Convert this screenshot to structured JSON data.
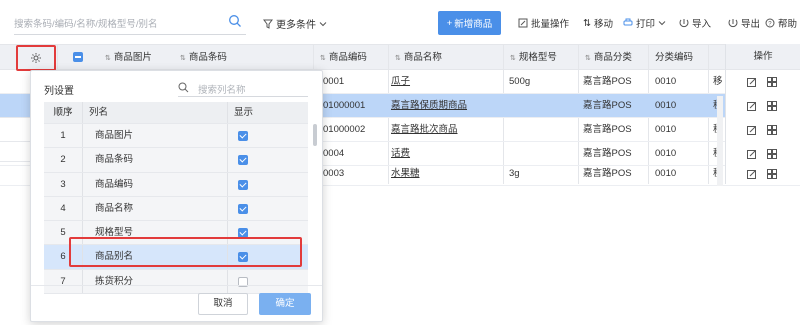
{
  "toolbar": {
    "search_placeholder": "搜索条码/编码/名称/规格型号/别名",
    "more_filters": "更多条件",
    "add_button": "新增商品",
    "batch": "批量操作",
    "move": "移动",
    "print": "打印",
    "import": "导入",
    "export": "导出",
    "help": "帮助"
  },
  "table": {
    "headers": [
      "商品图片",
      "商品条码",
      "商品编码",
      "商品名称",
      "规格型号",
      "商品分类",
      "分类编码",
      "操作"
    ],
    "rows": [
      {
        "code": "0001",
        "name": "瓜子",
        "spec": "500g",
        "category": "嘉言路POS",
        "cat_code": "0010",
        "extra": "移"
      },
      {
        "code": "01000001",
        "name": "嘉言路保质期商品",
        "spec": "",
        "category": "嘉言路POS",
        "cat_code": "0010",
        "extra": "移"
      },
      {
        "code": "01000002",
        "name": "嘉言路批次商品",
        "spec": "",
        "category": "嘉言路POS",
        "cat_code": "0010",
        "extra": "移"
      },
      {
        "code": "0004",
        "name": "话费",
        "spec": "",
        "category": "嘉言路POS",
        "cat_code": "0010",
        "extra": "移"
      },
      {
        "code": "0003",
        "name": "水果糖",
        "spec": "3g",
        "category": "嘉言路POS",
        "cat_code": "0010",
        "extra": "移"
      }
    ]
  },
  "popup": {
    "title": "列设置",
    "search_placeholder": "搜索列名称",
    "col_index": "顺序",
    "col_name": "列名",
    "col_show": "显示",
    "items": [
      {
        "index": "1",
        "name": "商品图片",
        "shown": true
      },
      {
        "index": "2",
        "name": "商品条码",
        "shown": true
      },
      {
        "index": "3",
        "name": "商品编码",
        "shown": true
      },
      {
        "index": "4",
        "name": "商品名称",
        "shown": true
      },
      {
        "index": "5",
        "name": "规格型号",
        "shown": true
      },
      {
        "index": "6",
        "name": "商品别名",
        "shown": true
      },
      {
        "index": "7",
        "name": "拣货积分",
        "shown": false
      }
    ],
    "cancel": "取消",
    "ok": "确定"
  },
  "colors": {
    "primary": "#4a8fe8",
    "highlight": "#e23b3b",
    "selected_row": "#bcd6f8"
  }
}
